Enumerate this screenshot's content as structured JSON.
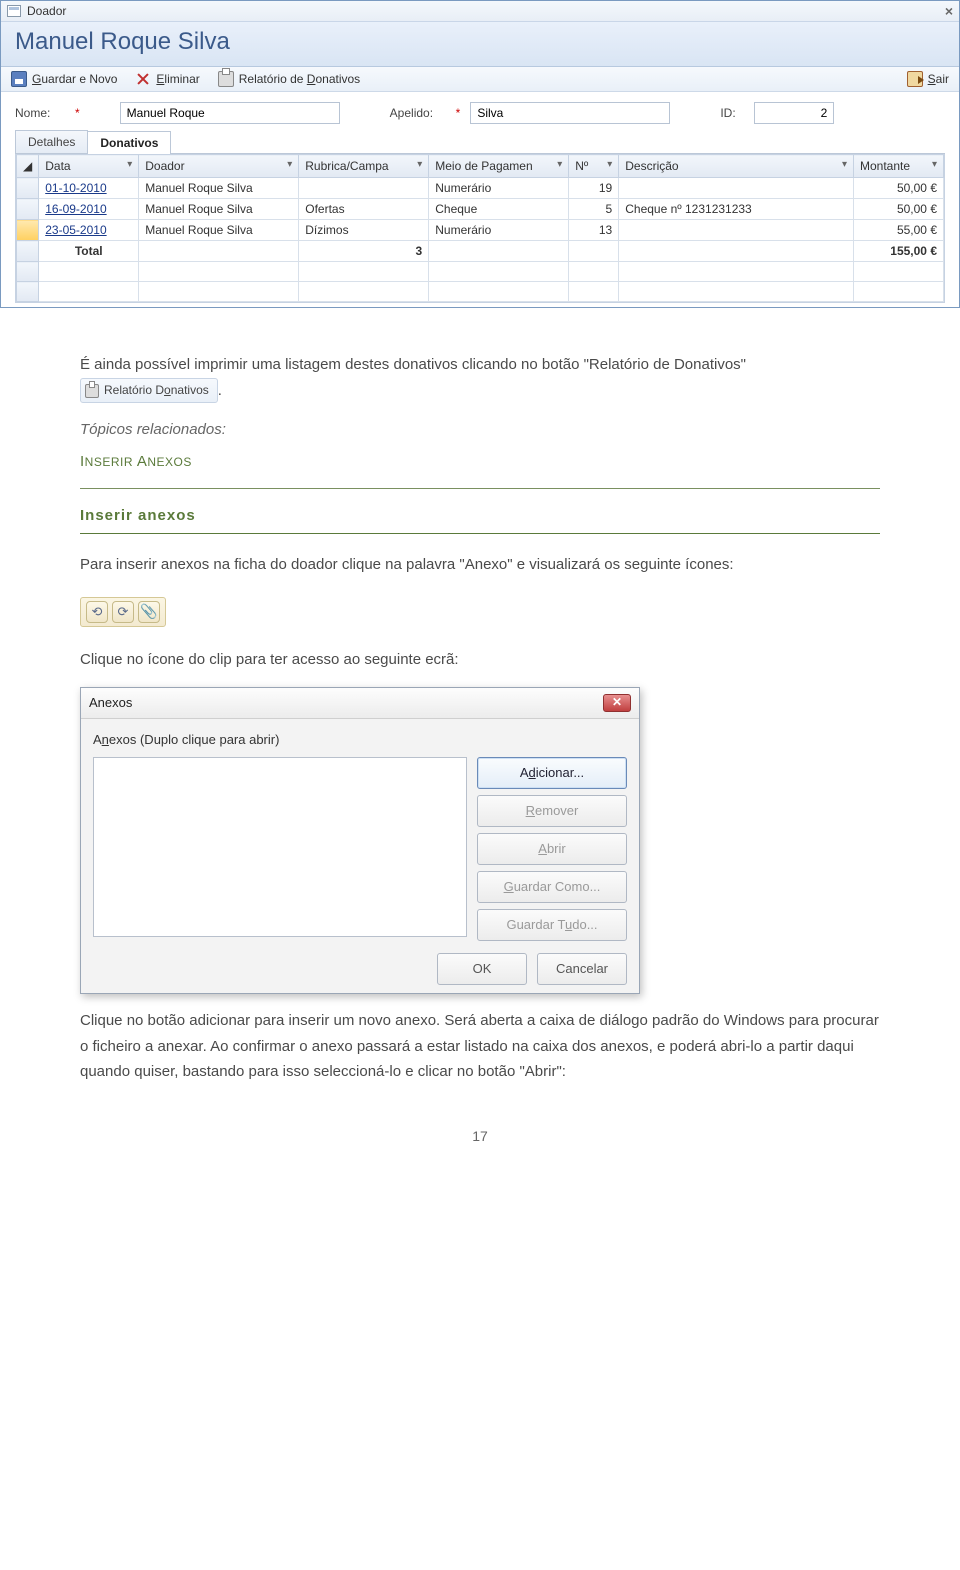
{
  "form": {
    "window_label": "Doador",
    "header": "Manuel Roque Silva",
    "toolbar": {
      "save": "Guardar e Novo",
      "delete": "Eliminar",
      "report": "Relatório de Donativos",
      "exit": "Sair"
    },
    "fields": {
      "name_label": "Nome:",
      "name_value": "Manuel Roque",
      "surname_label": "Apelido:",
      "surname_value": "Silva",
      "id_label": "ID:",
      "id_value": "2",
      "asterisk": "*"
    },
    "tabs": {
      "details": "Detalhes",
      "donations": "Donativos"
    },
    "grid": {
      "headers": [
        "Data",
        "Doador",
        "Rubrica/Campa",
        "Meio de Pagamen",
        "Nº",
        "Descrição",
        "Montante"
      ],
      "rows": [
        {
          "date": "01-10-2010",
          "donor": "Manuel Roque Silva",
          "rubrica": "",
          "method": "Numerário",
          "num": "19",
          "desc": "",
          "amount": "50,00 €"
        },
        {
          "date": "16-09-2010",
          "donor": "Manuel Roque Silva",
          "rubrica": "Ofertas",
          "method": "Cheque",
          "num": "5",
          "desc": "Cheque nº 1231231233",
          "amount": "50,00 €"
        },
        {
          "date": "23-05-2010",
          "donor": "Manuel Roque Silva",
          "rubrica": "Dízimos",
          "method": "Numerário",
          "num": "13",
          "desc": "",
          "amount": "55,00 €"
        }
      ],
      "total_label": "Total",
      "total_count": "3",
      "total_amount": "155,00 €"
    }
  },
  "body": {
    "p1a": "É ainda possível imprimir uma listagem destes donativos clicando no botão \"Relatório de Donativos\" ",
    "p1b": ".",
    "rel_btn": "Relatório Donativos",
    "topicos_label": "Tópicos relacionados:",
    "inserir_link": "Inserir Anexos",
    "section": "Inserir anexos",
    "p2": "Para inserir anexos na ficha do doador clique na palavra \"Anexo\" e visualizará os seguinte ícones:",
    "p3": "Clique no ícone do clip para ter acesso ao seguinte ecrã:",
    "p4": "Clique no botão adicionar para inserir um novo anexo. Será aberta a caixa de diálogo padrão do Windows para procurar o ficheiro a anexar. Ao confirmar o anexo passará a estar listado na caixa dos anexos, e poderá abri-lo a partir daqui quando quiser, bastando para isso seleccioná-lo e clicar no botão \"Abrir\":"
  },
  "dialog": {
    "title": "Anexos",
    "subtitle": "Anexos (Duplo clique para abrir)",
    "buttons": {
      "add": "Adicionar...",
      "remove": "Remover",
      "open": "Abrir",
      "saveas": "Guardar Como...",
      "saveall": "Guardar Tudo...",
      "ok": "OK",
      "cancel": "Cancelar"
    }
  },
  "page_number": "17"
}
